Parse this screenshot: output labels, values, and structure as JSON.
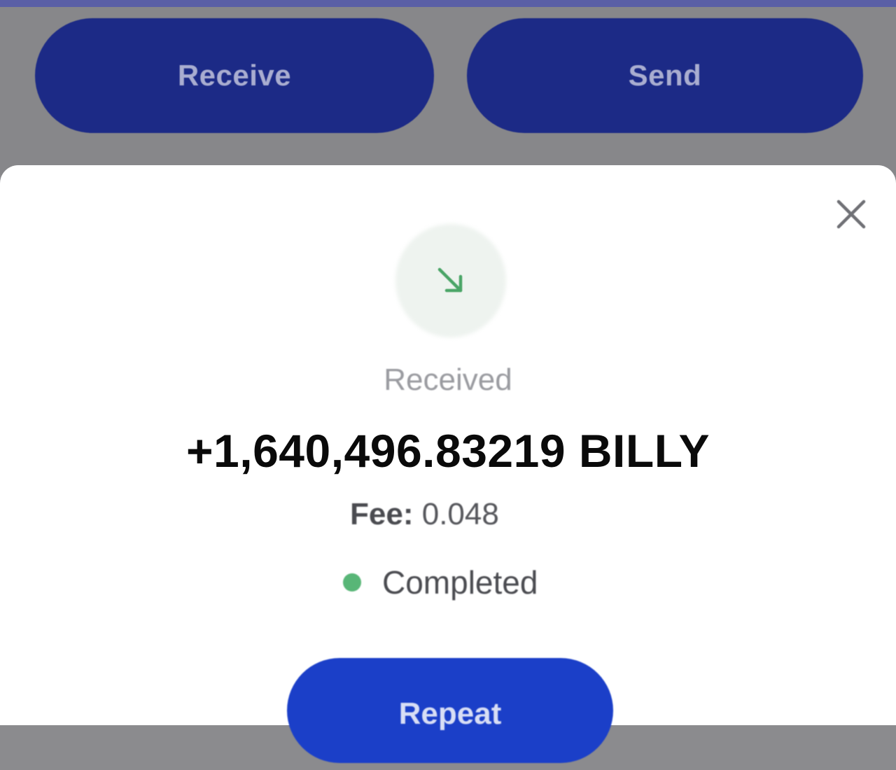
{
  "header_actions": {
    "receive_label": "Receive",
    "send_label": "Send"
  },
  "transaction": {
    "direction_icon": "arrow-down-right-icon",
    "status_heading": "Received",
    "amount": "+1,640,496.83219 BILLY",
    "fee_label": "Fee:",
    "fee_value": "0.048",
    "state": "Completed",
    "state_color": "#58b677"
  },
  "actions": {
    "repeat_label": "Repeat"
  },
  "colors": {
    "primary": "#1c2a86",
    "repeat_button": "#1b3fc8",
    "icon_green": "#4aa567"
  }
}
